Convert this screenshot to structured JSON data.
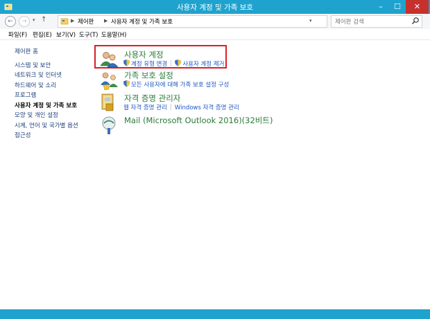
{
  "window": {
    "title": "사용자 계정 및 가족 보호"
  },
  "address": {
    "crumbs": [
      "제어판",
      "사용자 계정 및 가족 보호"
    ],
    "search_placeholder": "제어판 검색"
  },
  "menu": [
    "파일(F)",
    "편집(E)",
    "보기(V)",
    "도구(T)",
    "도움말(H)"
  ],
  "leftnav": {
    "home": "제어판 홈",
    "items": [
      "시스템 및 보안",
      "네트워크 및 인터넷",
      "하드웨어 및 소리",
      "프로그램",
      "사용자 계정 및 가족 보호",
      "모양 및 개인 설정",
      "시계, 언어 및 국가별 옵션",
      "접근성"
    ],
    "current_index": 4
  },
  "categories": [
    {
      "title": "사용자 계정",
      "links": [
        "계정 유형 변경",
        "사용자 계정 제거"
      ]
    },
    {
      "title": "가족 보호 설정",
      "links": [
        "모든 사용자에 대해 가족 보호 설정 구성"
      ]
    },
    {
      "title": "자격 증명 관리자",
      "links": [
        "웹 자격 증명 관리",
        "Windows 자격 증명 관리"
      ]
    },
    {
      "title": "Mail (Microsoft Outlook 2016)(32비트)",
      "links": []
    }
  ],
  "colors": {
    "titlebar": "#1fa3ce",
    "close": "#c7312d",
    "category": "#2b7a3a",
    "link": "#1f57c6",
    "highlight": "#d91e26"
  }
}
